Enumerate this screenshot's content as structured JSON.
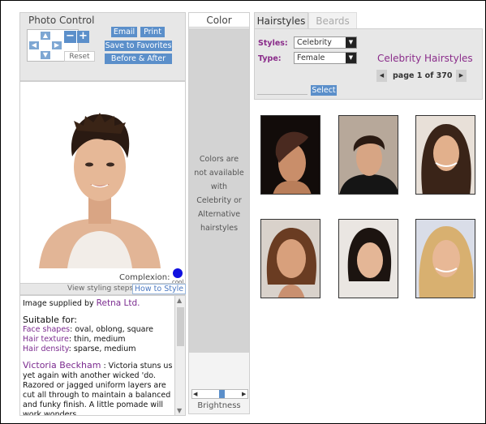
{
  "photo_control": {
    "title": "Photo Control",
    "email_label": "Email",
    "print_label": "Print",
    "save_label": "Save to Favorites",
    "before_after_label": "Before & After",
    "reset_label": "Reset",
    "zoom_out_label": "−",
    "zoom_in_label": "+"
  },
  "photo": {
    "complexion_label": "Complexion:",
    "complexion_value": "cool",
    "complexion_color": "#1010e0",
    "styling_steps_label": "View styling steps:",
    "how_to_style_label": "How to Style"
  },
  "info": {
    "supplied_prefix": "Image supplied by",
    "supplier": "Retna Ltd.",
    "suitable_heading": "Suitable for:",
    "face_shapes_label": "Face shapes",
    "face_shapes_value": ": oval, oblong, square",
    "hair_texture_label": "Hair texture",
    "hair_texture_value": ": thin, medium",
    "hair_density_label": "Hair density",
    "hair_density_value": ": sparse, medium",
    "celebrity_name": "Victoria Beckham",
    "description": ": Victoria stuns us yet again with another wicked 'do. Razored or jagged uniform layers are cut all through to maintain a balanced and funky finish. A little pomade will work wonders"
  },
  "color_panel": {
    "title": "Color",
    "message": "Colors are not available with Celebrity or Alternative hairstyles",
    "brightness_label": "Brightness"
  },
  "tabs": {
    "hairstyles": "Hairstyles",
    "beards": "Beards"
  },
  "filters": {
    "styles_label": "Styles:",
    "styles_value": "Celebrity",
    "type_label": "Type:",
    "type_value": "Female",
    "select_label": "Select",
    "category_title": "Celebrity Hairstyles",
    "page_label": "page 1 of 370"
  },
  "colors": {
    "accent_blue": "#5b8fca",
    "brand_purple": "#8a2c8a",
    "panel_gray": "#e7e7e7"
  },
  "thumbnails": [
    {
      "hair": "short dark asymmetric"
    },
    {
      "hair": "short dark pixie"
    },
    {
      "hair": "long dark wavy"
    },
    {
      "hair": "medium brown bob"
    },
    {
      "hair": "dark bob with bangs"
    },
    {
      "hair": "blonde curly"
    }
  ]
}
